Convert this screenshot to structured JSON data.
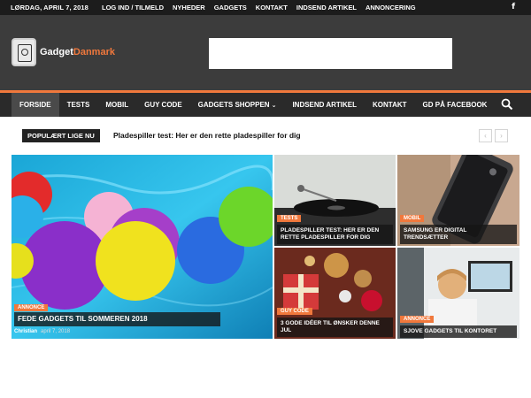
{
  "topbar": {
    "date": "LØRDAG, APRIL 7, 2018",
    "links": [
      "LOG IND / TILMELD",
      "NYHEDER",
      "GADGETS",
      "KONTAKT",
      "INDSEND ARTIKEL",
      "ANNONCERING"
    ],
    "facebook_glyph": "f"
  },
  "header": {
    "logo_part1": "Gadget",
    "logo_part2": "Danmark"
  },
  "nav": {
    "items": [
      "FORSIDE",
      "TESTS",
      "MOBIL",
      "GUY CODE",
      "GADGETS SHOPPEN",
      "INDSEND ARTIKEL",
      "KONTAKT",
      "GD PÅ FACEBOOK"
    ],
    "dropdown_chevron": "⌄"
  },
  "trending": {
    "label": "POPULÆRT LIGE NU",
    "text": "Pladespiller test: Her er den rette pladespiller for dig",
    "prev": "‹",
    "next": "›"
  },
  "tiles": {
    "main": {
      "category": "ANNONCE",
      "title": "FEDE GADGETS TIL SOMMEREN 2018",
      "author": "Christian",
      "date": "april 7, 2018"
    },
    "a": {
      "category": "TESTS",
      "title_line1": "PLADESPILLER TEST: HER ER DEN",
      "title_line2": "RETTE PLADESPILLER FOR DIG"
    },
    "b": {
      "category": "MOBIL",
      "title_line1": "SAMSUNG ER DIGITAL",
      "title_line2": "TRENDSÆTTER"
    },
    "c": {
      "category": "GUY CODE",
      "title_line1": "3 GODE IDÉER TIL ØNSKER DENNE",
      "title_line2": "JUL"
    },
    "d": {
      "category": "ANNONCE",
      "title": "SJOVE GADGETS TIL KONTORET"
    }
  },
  "colors": {
    "accent": "#f0783c",
    "header_bg": "#3c3c3c",
    "nav_bg": "#2a2a2a",
    "topbar_bg": "#1c1c1c"
  }
}
